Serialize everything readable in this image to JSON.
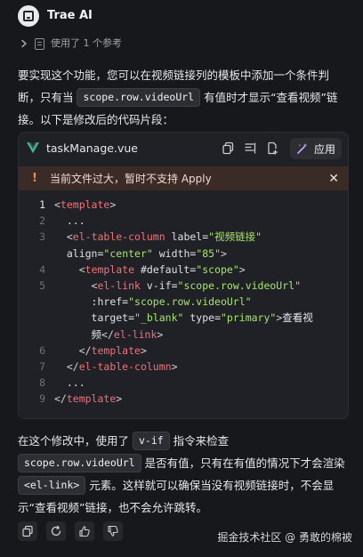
{
  "header": {
    "title": "Trae AI",
    "refs_label": "使用了 1 个参考"
  },
  "intro": {
    "text_before": "要实现这个功能，您可以在视频链接列的模板中添加一个条件判断，只有当 ",
    "code": "scope.row.videoUrl",
    "text_after": " 有值时才显示“查看视频”链接。以下是修改后的代码片段："
  },
  "code_card": {
    "file_name": "taskManage.vue",
    "apply_label": "应用",
    "warning": "当前文件过大，暂时不支持 Apply",
    "lines": [
      {
        "n": "1",
        "html": "<span class=\"punct\">&lt;</span><span class=\"tag\">template</span><span class=\"punct\">&gt;</span>"
      },
      {
        "n": "2",
        "html": "  ..."
      },
      {
        "n": "3",
        "html": "  <span class=\"punct\">&lt;</span><span class=\"tag\">el-table-column</span> <span class=\"attr\">label</span>=<span class=\"str\">\"视频链接\"</span>"
      },
      {
        "n": "",
        "html": "  <span class=\"attr\">align</span>=<span class=\"str\">\"center\"</span> <span class=\"attr\">width</span>=<span class=\"str\">\"85\"</span><span class=\"punct\">&gt;</span>"
      },
      {
        "n": "4",
        "html": "    <span class=\"punct\">&lt;</span><span class=\"tag\">template</span> <span class=\"attr\">#default</span>=<span class=\"str\">\"scope\"</span><span class=\"punct\">&gt;</span>"
      },
      {
        "n": "5",
        "html": "      <span class=\"punct\">&lt;</span><span class=\"tag\">el-link</span> <span class=\"attr\">v-if</span>=<span class=\"str\">\"scope.row.videoUrl\"</span>"
      },
      {
        "n": "",
        "html": "      <span class=\"attr\">:href</span>=<span class=\"str\">\"scope.row.videoUrl\"</span>"
      },
      {
        "n": "",
        "html": "      <span class=\"attr\">target</span>=<span class=\"str\">\"_blank\"</span> <span class=\"attr\">type</span>=<span class=\"str\">\"primary\"</span><span class=\"punct\">&gt;</span>查看视"
      },
      {
        "n": "",
        "html": "      频<span class=\"punct\">&lt;/</span><span class=\"tag\">el-link</span><span class=\"punct\">&gt;</span>"
      },
      {
        "n": "6",
        "html": "    <span class=\"punct\">&lt;/</span><span class=\"tag\">template</span><span class=\"punct\">&gt;</span>"
      },
      {
        "n": "7",
        "html": "  <span class=\"punct\">&lt;/</span><span class=\"tag\">el-table-column</span><span class=\"punct\">&gt;</span>"
      },
      {
        "n": "8",
        "html": "  ..."
      },
      {
        "n": "9",
        "html": "<span class=\"punct\">&lt;/</span><span class=\"tag\">template</span><span class=\"punct\">&gt;</span>"
      }
    ]
  },
  "outro": {
    "t1": "在这个修改中，使用了 ",
    "c1": "v-if",
    "t2": " 指令来检查",
    "c2": "scope.row.videoUrl",
    "t3": " 是否有值，只有在有值的情况下才会渲染 ",
    "c3": "<el-link>",
    "t4": " 元素。这样就可以确保当没有视频链接时，不会显示“查看视频”链接，也不会允许跳转。"
  },
  "watermark": "掘金技术社区 @ 勇敢的棉被",
  "colors": {
    "background": "#17181c",
    "card": "#1f2126",
    "warning_bg": "#3a2b27",
    "tag": "#f07178",
    "string": "#a7e36b"
  }
}
